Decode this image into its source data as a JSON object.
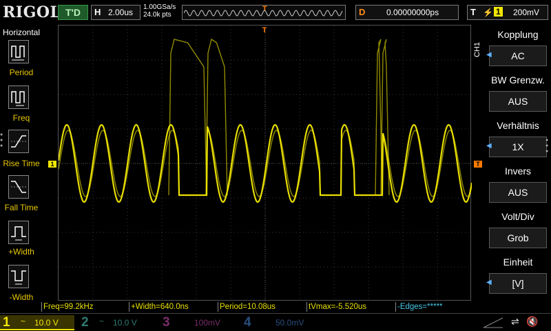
{
  "brand": "RIGOL",
  "run_state": "T'D",
  "timebase": {
    "label": "H",
    "value": "2.00us"
  },
  "sampling": {
    "rate": "1.00GSa/s",
    "points": "24.0k pts"
  },
  "trigger_pos_marker": "T",
  "delay": {
    "label": "D",
    "value": "0.00000000ps"
  },
  "trigger": {
    "label": "T",
    "channel": "1",
    "level": "200mV"
  },
  "left_panel": {
    "title": "Horizontal",
    "items": [
      "Period",
      "Freq",
      "Rise Time",
      "Fall Time",
      "+Width",
      "-Width"
    ]
  },
  "channel_tag": "CH1",
  "right_panel": [
    {
      "title": "Kopplung",
      "value": "AC",
      "has_arrow": true
    },
    {
      "title": "BW Grenzw.",
      "value": "AUS",
      "has_arrow": false
    },
    {
      "title": "Verhältnis",
      "value": "1X",
      "has_arrow": true
    },
    {
      "title": "Invers",
      "value": "AUS",
      "has_arrow": false
    },
    {
      "title": "Volt/Div",
      "value": "Grob",
      "has_arrow": false
    },
    {
      "title": "Einheit",
      "value": "[V]",
      "has_arrow": true
    }
  ],
  "measurements": [
    "Freq=99.2kHz",
    "+Width=640.0ns",
    "Period=10.08us",
    "tVmax=-5.520us",
    "-Edges=*****"
  ],
  "channels": [
    {
      "num": "1",
      "coupling": "~",
      "scale": "10.0 V"
    },
    {
      "num": "2",
      "coupling": "~",
      "scale": "10.0 V"
    },
    {
      "num": "3",
      "coupling": "",
      "scale": "100mV"
    },
    {
      "num": "4",
      "coupling": "",
      "scale": "50.0mV"
    }
  ],
  "ch1_marker": "1",
  "trig_level_marker": "T",
  "colors": {
    "ch1": "#f2e800",
    "ch2": "#2f7a72",
    "ch3": "#7a2d6a",
    "ch4": "#2a4f80",
    "trigger": "#ff7a00",
    "menu_arrow": "#5db0ff"
  }
}
